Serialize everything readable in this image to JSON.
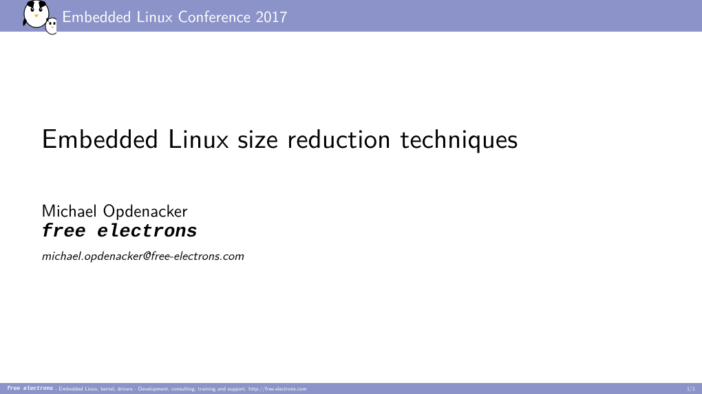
{
  "header": {
    "conference": "Embedded Linux Conference 2017"
  },
  "main": {
    "title": "Embedded Linux size reduction techniques",
    "author": "Michael Opdenacker",
    "company": "free electrons",
    "email": "michael.opdenacker@free-electrons.com"
  },
  "footer": {
    "company": "free electrons",
    "tagline": "- Embedded Linux, kernel, drivers - Development, consulting, training and support.",
    "url": "http://free-electrons.com",
    "page": "1/1"
  }
}
